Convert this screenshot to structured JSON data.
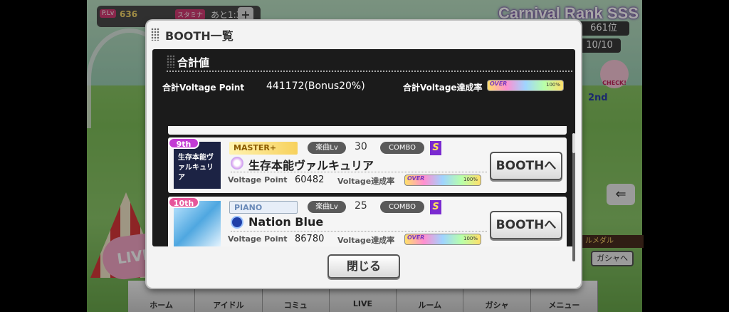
{
  "hud": {
    "plv_tag": "P.Lv",
    "plv": "636",
    "stamina_tag": "スタミナ",
    "stamina_time": "あと1:32",
    "plus": "+",
    "carnival_rank": "Carnival Rank SSS",
    "rank_position": "661位",
    "count": "10/10"
  },
  "side": {
    "check": "CHECK!",
    "second": "2nd",
    "medal": "ルメダル",
    "gacha": "ガシャへ",
    "arrow": "⇐"
  },
  "bottom_nav": [
    "ホーム",
    "アイドル",
    "コミュ",
    "LIVE",
    "ルーム",
    "ガシャ",
    "メニュー"
  ],
  "modal": {
    "title": "BOOTH一覧",
    "summary_heading": "合計値",
    "total_vp_label": "合計Voltage Point",
    "total_vp_value": "441172(Bonus20%)",
    "total_rate_label": "合計Voltage達成率",
    "total_gauge": {
      "over": "OVER",
      "pct": "100%",
      "level": 1.0
    },
    "close_label": "閉じる"
  },
  "booths": [
    {
      "rank": "9th",
      "difficulty": "MASTER+",
      "level_label": "楽曲Lv",
      "level": "30",
      "combo_label": "COMBO",
      "combo_rank": "S",
      "title": "生存本能ヴァルキュリア",
      "jacket_text": "生存本能ヴァルキュリア",
      "vp_label": "Voltage Point",
      "vp": "60482",
      "rate_label": "Voltage達成率",
      "gauge": {
        "over": "OVER",
        "pct": "100%",
        "level": 1.0
      },
      "button": "BOOTHへ"
    },
    {
      "rank": "10th",
      "difficulty": "PIANO",
      "level_label": "楽曲Lv",
      "level": "25",
      "combo_label": "COMBO",
      "combo_rank": "S",
      "title": "Nation Blue",
      "jacket_text": "",
      "vp_label": "Voltage Point",
      "vp": "86780",
      "rate_label": "Voltage達成率",
      "gauge": {
        "over": "OVER",
        "pct": "100%",
        "level": 1.0
      },
      "button": "BOOTHへ"
    }
  ]
}
